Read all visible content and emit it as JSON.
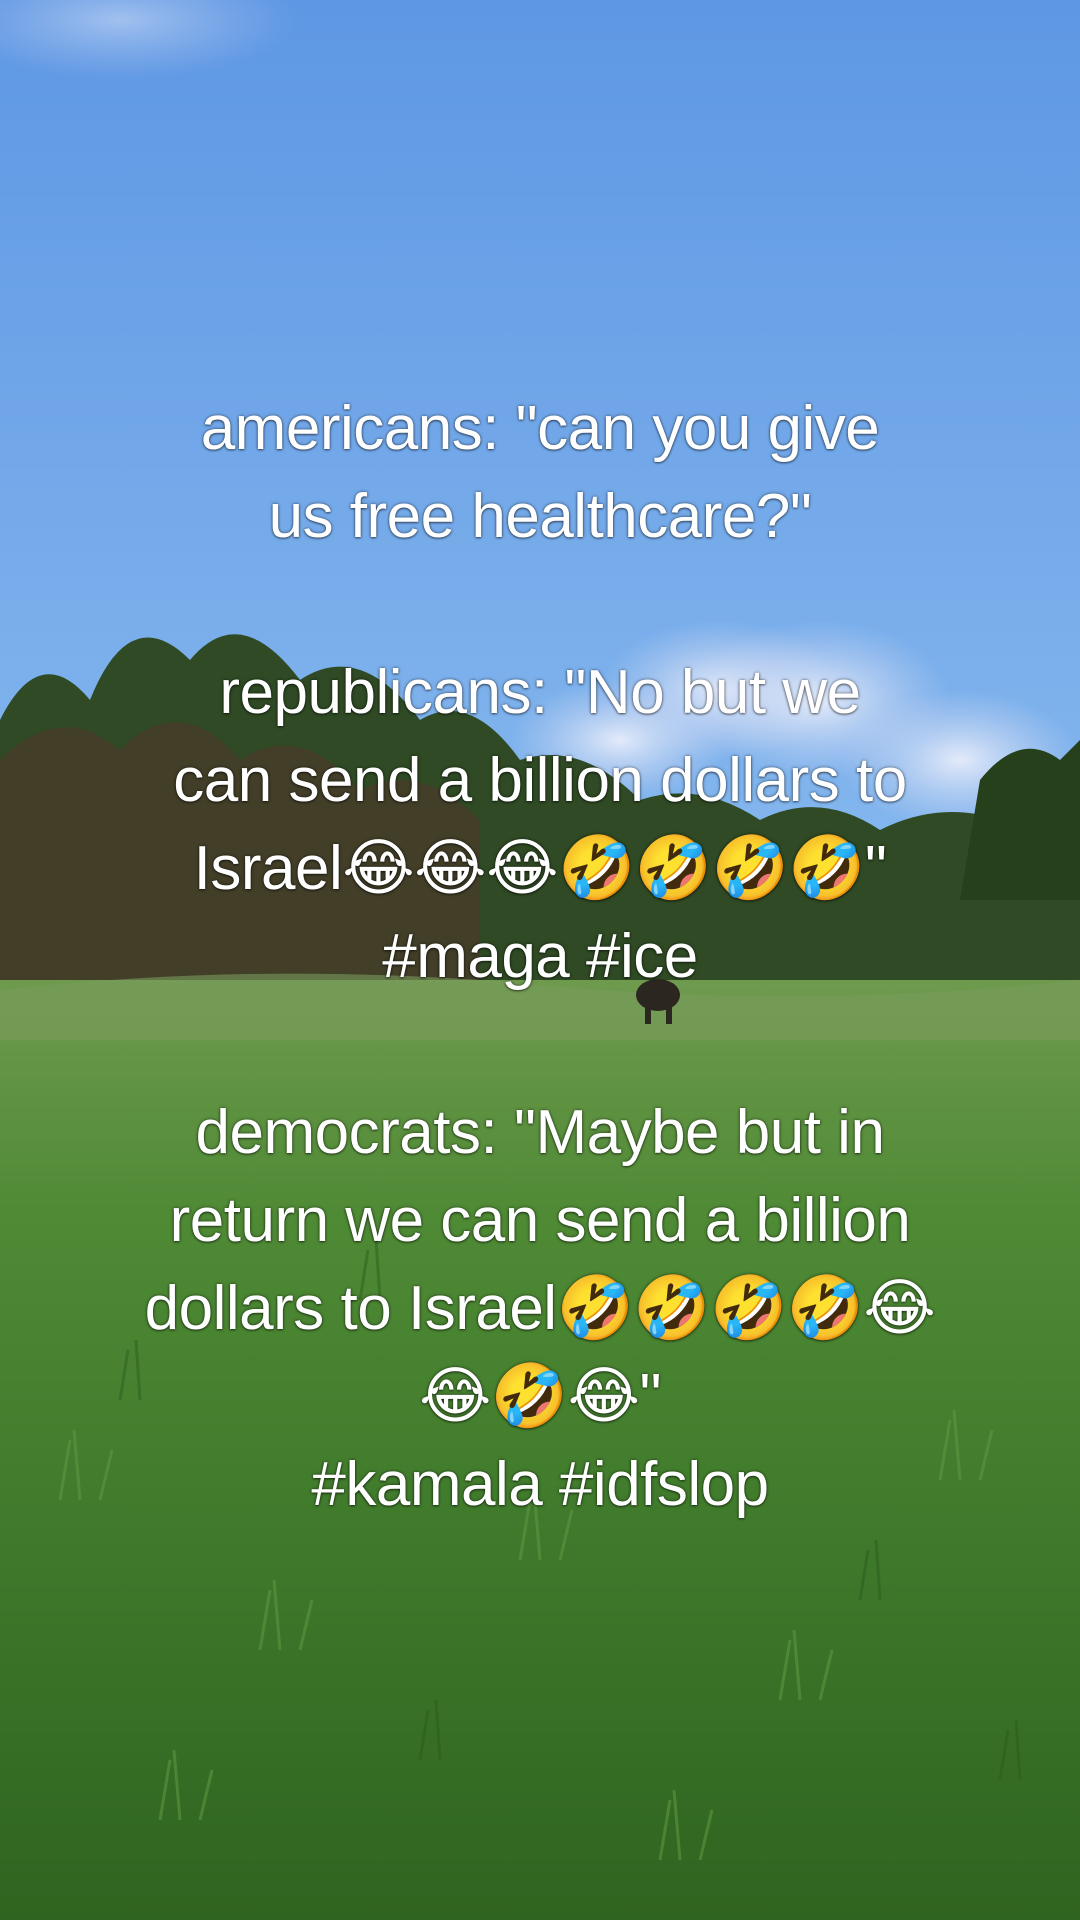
{
  "video": {
    "caption_lines": [
      "americans: \"can you give",
      "us free healthcare?\"",
      "",
      "republicans: \"No but we",
      "can send a billion dollars to",
      "Israel😂😂😂🤣🤣🤣🤣\"",
      "#maga #ice",
      "",
      "democrats: \"Maybe but in",
      "return we can send a billion",
      "dollars to Israel🤣🤣🤣🤣😂",
      "😂🤣😂\"",
      "#kamala #idfslop"
    ]
  },
  "colors": {
    "sky_top": "#5f9ae6",
    "sky_bottom": "#a9d0f5",
    "grass": "#3f7a2f",
    "caption_text": "#ffffff"
  }
}
